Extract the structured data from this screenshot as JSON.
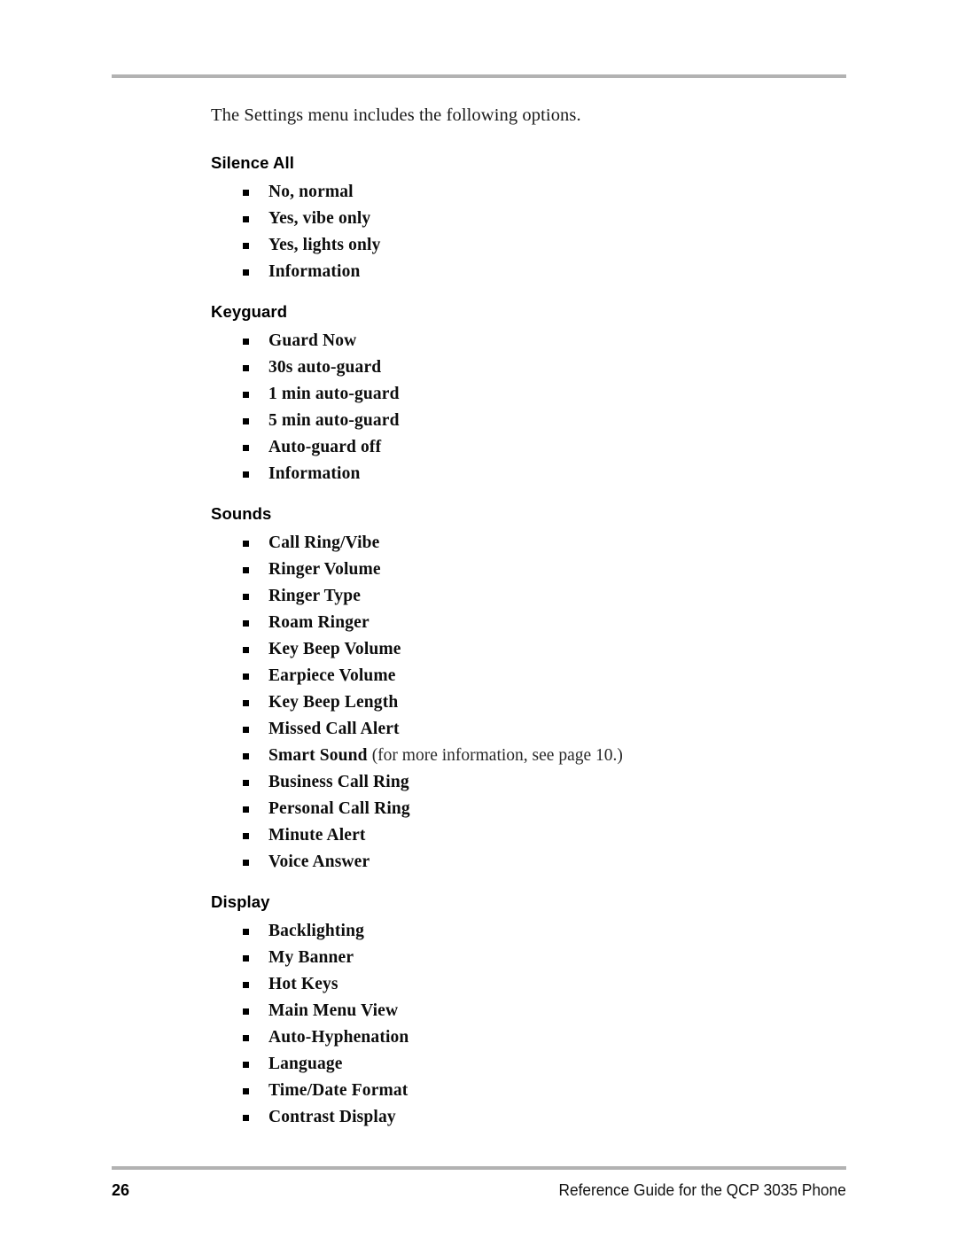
{
  "page": {
    "intro": "The Settings menu includes the following options.",
    "rule_color": "#b2b2b2",
    "background_color": "#ffffff",
    "text_color": "#000000"
  },
  "sections": [
    {
      "heading": "Silence All",
      "items": [
        {
          "text": "No, normal"
        },
        {
          "text": "Yes, vibe only"
        },
        {
          "text": "Yes, lights only"
        },
        {
          "text": "Information"
        }
      ]
    },
    {
      "heading": "Keyguard",
      "items": [
        {
          "text": "Guard Now"
        },
        {
          "text": "30s auto-guard"
        },
        {
          "text": "1 min auto-guard"
        },
        {
          "text": "5 min auto-guard"
        },
        {
          "text": "Auto-guard off"
        },
        {
          "text": "Information"
        }
      ]
    },
    {
      "heading": "Sounds",
      "items": [
        {
          "text": "Call Ring/Vibe"
        },
        {
          "text": "Ringer Volume"
        },
        {
          "text": "Ringer Type"
        },
        {
          "text": "Roam Ringer"
        },
        {
          "text": "Key Beep Volume"
        },
        {
          "text": "Earpiece Volume"
        },
        {
          "text": "Key Beep Length"
        },
        {
          "text": "Missed Call Alert"
        },
        {
          "text": "Smart Sound",
          "note": "(for more information, see page 10.)"
        },
        {
          "text": "Business Call Ring"
        },
        {
          "text": "Personal Call Ring"
        },
        {
          "text": "Minute Alert"
        },
        {
          "text": "Voice Answer"
        }
      ]
    },
    {
      "heading": "Display",
      "items": [
        {
          "text": "Backlighting"
        },
        {
          "text": "My Banner"
        },
        {
          "text": "Hot Keys"
        },
        {
          "text": "Main Menu View"
        },
        {
          "text": "Auto-Hyphenation"
        },
        {
          "text": "Language"
        },
        {
          "text": "Time/Date Format"
        },
        {
          "text": "Contrast Display"
        }
      ]
    }
  ],
  "footer": {
    "page_number": "26",
    "title": "Reference Guide for the QCP 3035 Phone"
  }
}
